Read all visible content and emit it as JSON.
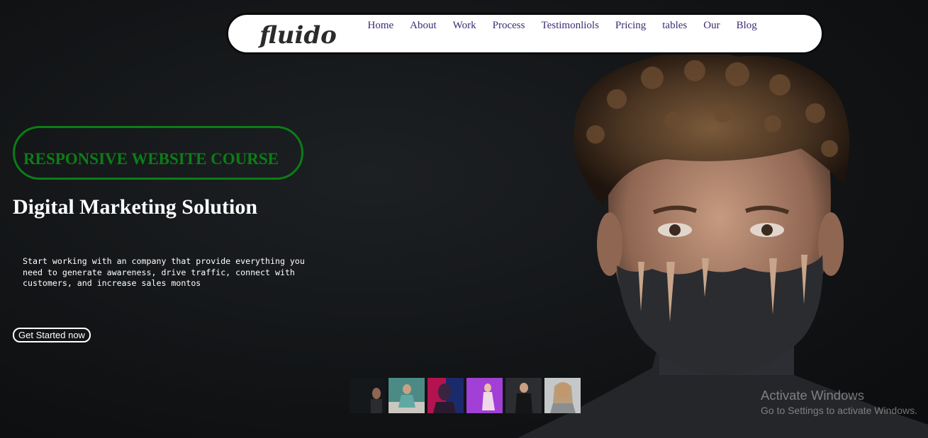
{
  "brand": {
    "logo_text": "fluido"
  },
  "nav": {
    "items": [
      {
        "label": "Home"
      },
      {
        "label": "About"
      },
      {
        "label": "Work"
      },
      {
        "label": "Process"
      },
      {
        "label": "Testimonliols"
      },
      {
        "label": "Pricing"
      },
      {
        "label": "tables"
      },
      {
        "label": "Our"
      },
      {
        "label": "Blog"
      }
    ]
  },
  "hero": {
    "badge": "RESPONSIVE WEBSITE COURSE",
    "headline": "Digital Marketing Solution",
    "description": "Start working with an company that provide everything you need to generate awareness, drive traffic, connect with customers, and increase sales montos",
    "cta_label": "Get Started now"
  },
  "thumbnails": [
    {
      "name": "thumbnail-1"
    },
    {
      "name": "thumbnail-2"
    },
    {
      "name": "thumbnail-3"
    },
    {
      "name": "thumbnail-4"
    },
    {
      "name": "thumbnail-5"
    },
    {
      "name": "thumbnail-6"
    }
  ],
  "watermark": {
    "title": "Activate Windows",
    "subtitle": "Go to Settings to activate Windows."
  },
  "colors": {
    "accent_green": "#0c7d17",
    "nav_link": "#3e2a73",
    "background": "#121416"
  }
}
